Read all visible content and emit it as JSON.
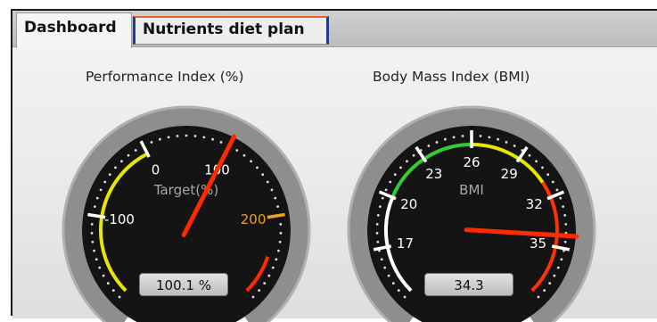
{
  "tabs": [
    {
      "label": "Dashboard",
      "active": true
    },
    {
      "label": "Nutrients diet plan",
      "active": false
    }
  ],
  "gauges": {
    "performance": {
      "title": "Performance Index (%)",
      "center_label": "Target(%)",
      "readout": "100.1 %",
      "value": 100.1,
      "range": [
        -200,
        300
      ],
      "ticks": [
        {
          "value": -100,
          "label": "-100",
          "color": "#ffffff"
        },
        {
          "value": 0,
          "label": "0",
          "color": "#ffffff"
        },
        {
          "value": 100,
          "label": "100",
          "color": "#ffffff"
        },
        {
          "value": 200,
          "label": "200",
          "color": "#f0a020"
        }
      ],
      "bands": [
        {
          "from": -200,
          "to": 0,
          "color": "#e6e600"
        },
        {
          "from": 250,
          "to": 300,
          "color": "#ff2a00"
        }
      ],
      "needle_color": "#ff2a00"
    },
    "bmi": {
      "title": "Body Mass Index (BMI)",
      "center_label": "BMI",
      "readout": "34.3",
      "value": 34.3,
      "range": [
        14,
        38
      ],
      "ticks": [
        {
          "value": 17,
          "label": "17",
          "color": "#ffffff"
        },
        {
          "value": 20,
          "label": "20",
          "color": "#ffffff"
        },
        {
          "value": 23,
          "label": "23",
          "color": "#ffffff"
        },
        {
          "value": 26,
          "label": "26",
          "color": "#ffffff"
        },
        {
          "value": 29,
          "label": "29",
          "color": "#ffffff"
        },
        {
          "value": 32,
          "label": "32",
          "color": "#ffffff"
        },
        {
          "value": 35,
          "label": "35",
          "color": "#ffffff"
        }
      ],
      "bands": [
        {
          "from": 14,
          "to": 20,
          "color": "#ffffff"
        },
        {
          "from": 20,
          "to": 26,
          "color": "#33cc33"
        },
        {
          "from": 26,
          "to": 31,
          "color": "#e6e600"
        },
        {
          "from": 31,
          "to": 38,
          "color": "#ff3300"
        }
      ],
      "needle_color": "#ff2a00"
    }
  }
}
